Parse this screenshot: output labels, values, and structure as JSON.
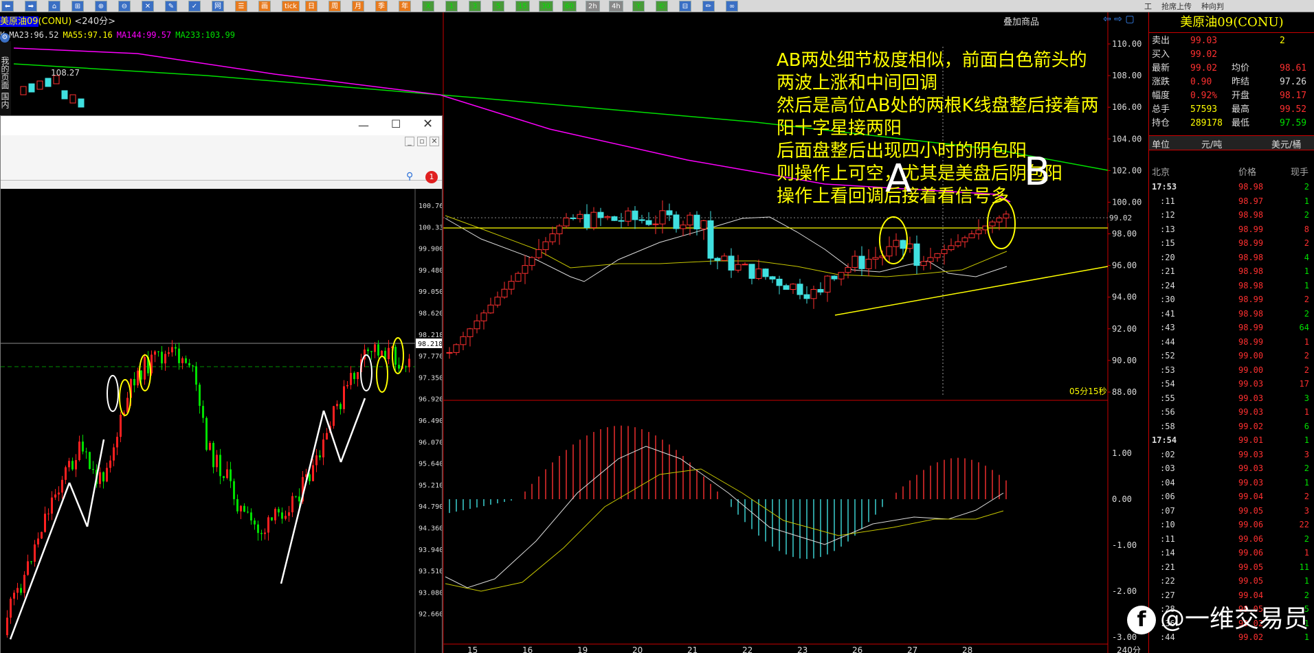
{
  "toolbar": {
    "buttons": [
      "⬅",
      "➡",
      "⌂",
      "⊞",
      "⊕",
      "⊖",
      "✕",
      "✎",
      "✓",
      "网",
      "☰",
      "画",
      "tick",
      "日",
      "周",
      "月",
      "季",
      "年",
      "X",
      "1",
      "3",
      "5",
      "15",
      "30",
      "60",
      "2h",
      "4h",
      "Y",
      "©",
      "⊟",
      "✏",
      "∞"
    ],
    "right_items": [
      "工",
      "抢席上传",
      "种向判"
    ]
  },
  "left_chart": {
    "symbol": "美原油09",
    "code": "(CONU)",
    "period": "<240分>",
    "ma_labels": [
      {
        "text": "K",
        "color": "#dddddd"
      },
      {
        "text": "MA23:96.52",
        "color": "#dddddd"
      },
      {
        "text": "MA55:97.16",
        "color": "#ffff00"
      },
      {
        "text": "MA144:99.57",
        "color": "#ff00ff"
      },
      {
        "text": "MA233:103.99",
        "color": "#00e000"
      }
    ],
    "high_label": "108.27",
    "sidebar_text": "我的页面 国内"
  },
  "mt_window": {
    "price_axis": [
      "100.760",
      "100.330",
      "99.900",
      "99.480",
      "99.050",
      "98.620",
      "98.218",
      "97.770",
      "97.350",
      "96.920",
      "96.490",
      "96.070",
      "95.640",
      "95.210",
      "94.790",
      "94.360",
      "93.940",
      "93.510",
      "93.080",
      "92.660"
    ],
    "current_price": "98.218",
    "badge": "1"
  },
  "main_chart": {
    "overlay_label": "叠加商品",
    "price_axis": [
      "110.00",
      "108.00",
      "106.00",
      "104.00",
      "102.00",
      "100.00",
      "98.00",
      "96.00",
      "94.00",
      "92.00",
      "90.00",
      "88.00"
    ],
    "current_price": "99.02",
    "countdown": "05分15秒",
    "macd_axis": [
      "1.00",
      "0.00",
      "-1.00",
      "-2.00",
      "-3.00"
    ],
    "date_axis": [
      "15",
      "16",
      "19",
      "20",
      "21",
      "22",
      "23",
      "26",
      "27",
      "28"
    ],
    "period_label": "240分",
    "annotation": [
      "AB两处细节极度相似，前面白色箭头的两波上涨和中间回调",
      "然后是高位AB处的两根K线盘整后接着两阳十字星接两阳",
      "后面盘整后出现四小时的阴包阳",
      "则操作上可空，尤其是美盘后阴包阳",
      "操作上看回调后接着看信号多"
    ],
    "mark_a": "A",
    "mark_b": "B"
  },
  "right_panel": {
    "title": "美原油09(CONU)",
    "quote": [
      {
        "l1": "卖出",
        "v1": "99.03",
        "c1": "red",
        "l2": "",
        "v2": "2",
        "c2": "yellow"
      },
      {
        "l1": "买入",
        "v1": "99.02",
        "c1": "red",
        "l2": "",
        "v2": "",
        "c2": "yellow"
      },
      {
        "l1": "最新",
        "v1": "99.02",
        "c1": "red",
        "l2": "均价",
        "v2": "98.61",
        "c2": "red"
      },
      {
        "l1": "涨跌",
        "v1": "0.90",
        "c1": "red",
        "l2": "昨结",
        "v2": "97.26",
        "c2": "white"
      },
      {
        "l1": "幅度",
        "v1": "0.92%",
        "c1": "red",
        "l2": "开盘",
        "v2": "98.17",
        "c2": "red"
      },
      {
        "l1": "总手",
        "v1": "57593",
        "c1": "yellow",
        "l2": "最高",
        "v2": "99.52",
        "c2": "red"
      },
      {
        "l1": "持仓",
        "v1": "289178",
        "c1": "yellow",
        "l2": "最低",
        "v2": "97.59",
        "c2": "green"
      }
    ],
    "unit_label": "单位",
    "unit_value": "元/吨",
    "unit_alt": "美元/桶",
    "tick_headers": [
      "北京",
      "价格",
      "现手"
    ],
    "ticks": [
      {
        "t": "17:53",
        "p": "98.98",
        "v": "2",
        "pc": "red",
        "vc": "green",
        "bold": true
      },
      {
        "t": ":11",
        "p": "98.97",
        "v": "1",
        "pc": "red",
        "vc": "green"
      },
      {
        "t": ":12",
        "p": "98.98",
        "v": "2",
        "pc": "red",
        "vc": "green"
      },
      {
        "t": ":13",
        "p": "98.99",
        "v": "8",
        "pc": "red",
        "vc": "red"
      },
      {
        "t": ":15",
        "p": "98.99",
        "v": "2",
        "pc": "red",
        "vc": "red"
      },
      {
        "t": ":20",
        "p": "98.98",
        "v": "4",
        "pc": "red",
        "vc": "green"
      },
      {
        "t": ":21",
        "p": "98.98",
        "v": "1",
        "pc": "red",
        "vc": "green"
      },
      {
        "t": ":24",
        "p": "98.98",
        "v": "1",
        "pc": "red",
        "vc": "green"
      },
      {
        "t": ":30",
        "p": "98.99",
        "v": "2",
        "pc": "red",
        "vc": "red"
      },
      {
        "t": ":41",
        "p": "98.98",
        "v": "2",
        "pc": "red",
        "vc": "green"
      },
      {
        "t": ":43",
        "p": "98.99",
        "v": "64",
        "pc": "red",
        "vc": "green"
      },
      {
        "t": ":44",
        "p": "98.99",
        "v": "1",
        "pc": "red",
        "vc": "red"
      },
      {
        "t": ":52",
        "p": "99.00",
        "v": "2",
        "pc": "red",
        "vc": "red"
      },
      {
        "t": ":53",
        "p": "99.00",
        "v": "2",
        "pc": "red",
        "vc": "red"
      },
      {
        "t": ":54",
        "p": "99.03",
        "v": "17",
        "pc": "red",
        "vc": "red"
      },
      {
        "t": ":55",
        "p": "99.03",
        "v": "3",
        "pc": "red",
        "vc": "green"
      },
      {
        "t": ":56",
        "p": "99.03",
        "v": "1",
        "pc": "red",
        "vc": "red"
      },
      {
        "t": ":58",
        "p": "99.02",
        "v": "6",
        "pc": "red",
        "vc": "green"
      },
      {
        "t": "17:54",
        "p": "99.01",
        "v": "1",
        "pc": "red",
        "vc": "green",
        "bold": true
      },
      {
        "t": ":02",
        "p": "99.03",
        "v": "3",
        "pc": "red",
        "vc": "red"
      },
      {
        "t": ":03",
        "p": "99.03",
        "v": "2",
        "pc": "red",
        "vc": "green"
      },
      {
        "t": ":04",
        "p": "99.03",
        "v": "1",
        "pc": "red",
        "vc": "green"
      },
      {
        "t": ":06",
        "p": "99.04",
        "v": "2",
        "pc": "red",
        "vc": "red"
      },
      {
        "t": ":07",
        "p": "99.05",
        "v": "3",
        "pc": "red",
        "vc": "red"
      },
      {
        "t": ":10",
        "p": "99.06",
        "v": "22",
        "pc": "red",
        "vc": "red"
      },
      {
        "t": ":11",
        "p": "99.06",
        "v": "2",
        "pc": "red",
        "vc": "green"
      },
      {
        "t": ":14",
        "p": "99.06",
        "v": "1",
        "pc": "red",
        "vc": "red"
      },
      {
        "t": ":21",
        "p": "99.05",
        "v": "11",
        "pc": "red",
        "vc": "green"
      },
      {
        "t": ":22",
        "p": "99.05",
        "v": "1",
        "pc": "red",
        "vc": "green"
      },
      {
        "t": ":27",
        "p": "99.04",
        "v": "2",
        "pc": "red",
        "vc": "green"
      },
      {
        "t": ":28",
        "p": "99.05",
        "v": "5",
        "pc": "red",
        "vc": "green"
      },
      {
        "t": ":36",
        "p": "99.02",
        "v": "1",
        "pc": "red",
        "vc": "green"
      },
      {
        "t": ":44",
        "p": "99.02",
        "v": "1",
        "pc": "red",
        "vc": "green"
      }
    ]
  },
  "watermark": {
    "logo": "f",
    "text": "@一维交易员"
  }
}
